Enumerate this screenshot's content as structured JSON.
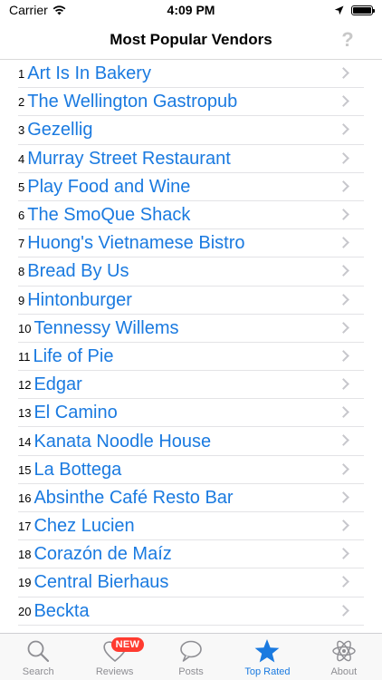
{
  "status_bar": {
    "carrier": "Carrier",
    "time": "4:09 PM",
    "battery_level": 1.0
  },
  "nav": {
    "title": "Most Popular Vendors",
    "help_label": "?"
  },
  "vendors": [
    {
      "rank": "1",
      "name": "Art Is In Bakery"
    },
    {
      "rank": "2",
      "name": "The Wellington Gastropub"
    },
    {
      "rank": "3",
      "name": "Gezellig"
    },
    {
      "rank": "4",
      "name": "Murray Street Restaurant"
    },
    {
      "rank": "5",
      "name": "Play Food and Wine"
    },
    {
      "rank": "6",
      "name": "The SmoQue Shack"
    },
    {
      "rank": "7",
      "name": "Huong's Vietnamese Bistro"
    },
    {
      "rank": "8",
      "name": "Bread By Us"
    },
    {
      "rank": "9",
      "name": "Hintonburger"
    },
    {
      "rank": "10",
      "name": "Tennessy Willems"
    },
    {
      "rank": "11",
      "name": "Life of Pie"
    },
    {
      "rank": "12",
      "name": "Edgar"
    },
    {
      "rank": "13",
      "name": "El Camino"
    },
    {
      "rank": "14",
      "name": "Kanata Noodle House"
    },
    {
      "rank": "15",
      "name": "La Bottega"
    },
    {
      "rank": "16",
      "name": "Absinthe Café Resto Bar"
    },
    {
      "rank": "17",
      "name": "Chez Lucien"
    },
    {
      "rank": "18",
      "name": "Corazón de Maíz"
    },
    {
      "rank": "19",
      "name": "Central Bierhaus"
    },
    {
      "rank": "20",
      "name": "Beckta"
    }
  ],
  "tabs": [
    {
      "id": "search",
      "label": "Search",
      "icon": "search-icon",
      "active": false
    },
    {
      "id": "reviews",
      "label": "Reviews",
      "icon": "heart-icon",
      "active": false,
      "badge": "NEW"
    },
    {
      "id": "posts",
      "label": "Posts",
      "icon": "speech-bubble-icon",
      "active": false
    },
    {
      "id": "top-rated",
      "label": "Top Rated",
      "icon": "star-icon",
      "active": true
    },
    {
      "id": "about",
      "label": "About",
      "icon": "atom-icon",
      "active": false
    }
  ],
  "colors": {
    "link_blue": "#1a7ae0",
    "badge_red": "#ff3b30",
    "inactive_gray": "#8e8e93"
  }
}
